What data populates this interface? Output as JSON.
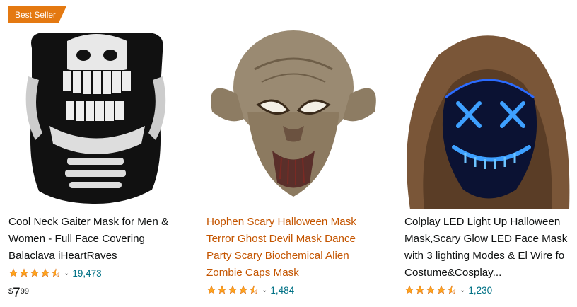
{
  "products": [
    {
      "badge": "Best Seller",
      "image_icon": "skull-neck-gaiter-image",
      "title_lines": [
        "Cool Neck Gaiter Mask for Men &",
        "Women - Full Face Covering",
        "Balaclava iHeartRaves"
      ],
      "rating": 4.5,
      "reviews": "19,473",
      "price": {
        "symbol": "$",
        "whole": "7",
        "fraction": "99"
      }
    },
    {
      "image_icon": "alien-latex-mask-image",
      "title_lines": [
        "Hophen Scary Halloween Mask",
        "Terror Ghost Devil Mask Dance",
        "Party Scary Biochemical Alien",
        "Zombie Caps Mask"
      ],
      "rating": 4.5,
      "reviews": "1,484"
    },
    {
      "image_icon": "led-mask-hood-image",
      "title_lines": [
        "Colplay LED Light Up Halloween",
        "Mask,Scary Glow LED Face Mask",
        "with 3 lighting Modes & El Wire fo",
        "Costume&Cosplay..."
      ],
      "rating": 4.5,
      "reviews": "1,230"
    }
  ],
  "colors": {
    "badge": "#e47911",
    "star": "#ffa41c",
    "link": "#007185",
    "title_hover": "#c45500"
  }
}
